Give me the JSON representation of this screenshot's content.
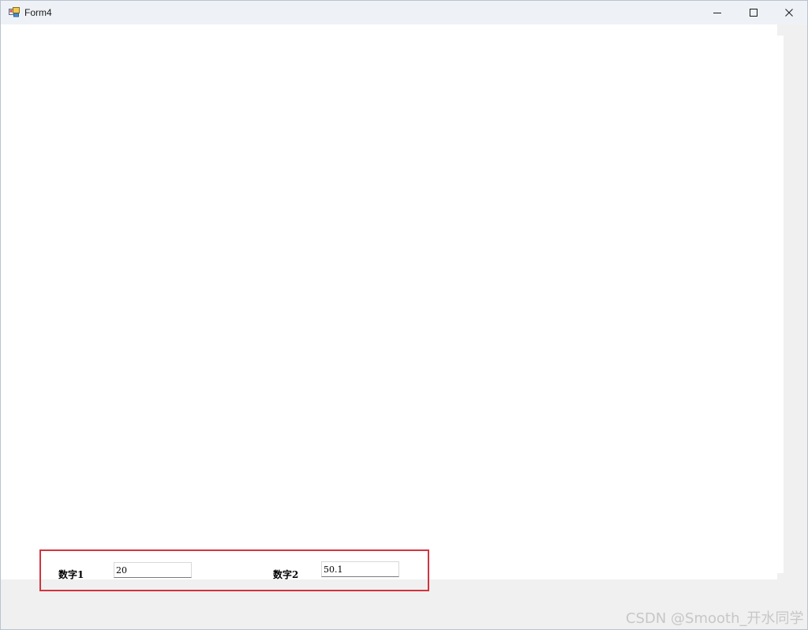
{
  "window": {
    "title": "Form4",
    "icon": "winforms-app-icon",
    "controls": {
      "minimize_icon": "minimize-icon",
      "maximize_icon": "maximize-icon",
      "close_icon": "close-icon"
    }
  },
  "form": {
    "field1": {
      "label": "数字1",
      "value": "20"
    },
    "field2": {
      "label": "数字2",
      "value": "50.1"
    }
  },
  "highlight_color": "#d1343f",
  "watermark": "CSDN @Smooth_开水同学"
}
